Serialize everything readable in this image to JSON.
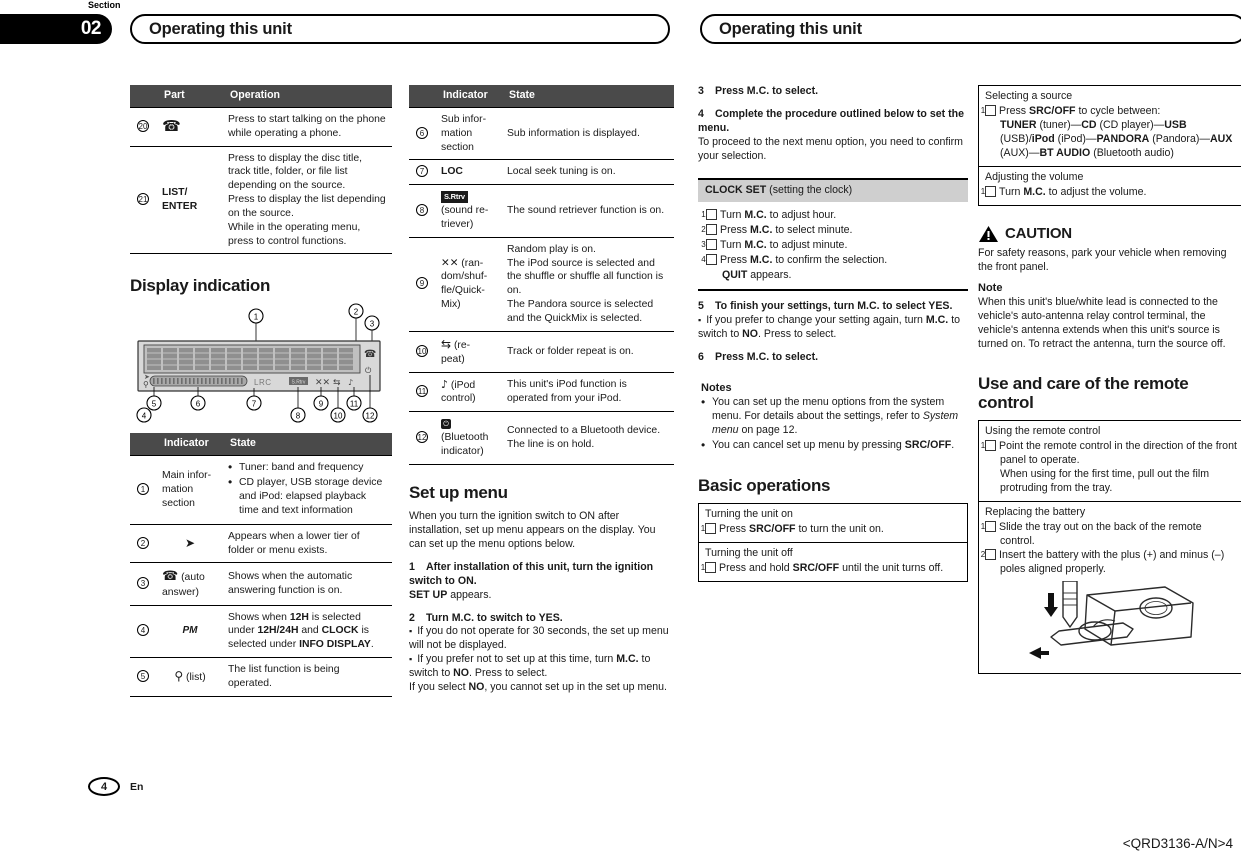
{
  "header": {
    "section_word": "Section",
    "section_number": "02",
    "title_left": "Operating this unit",
    "title_right": "Operating this unit"
  },
  "footer": {
    "page_number": "4",
    "language": "En",
    "part_number": "<QRD3136-A/N>4"
  },
  "col1": {
    "part_table": {
      "headers": {
        "num": "",
        "part": "Part",
        "operation": "Operation"
      },
      "rows": [
        {
          "num": "20",
          "part_icon": "phone-handset-icon",
          "part": "",
          "operation": "Press to start talking on the phone while operating a phone."
        },
        {
          "num": "21",
          "part_icon": "",
          "part": "LIST/ENTER",
          "operation": "Press to display the disc title, track title, folder, or file list depending on the source. Press to display the list depending on the source. While in the operating menu, press to control functions."
        }
      ]
    },
    "display_heading": "Display indication",
    "figure_callouts": [
      "1",
      "2",
      "3",
      "4",
      "5",
      "6",
      "7",
      "8",
      "9",
      "10",
      "11",
      "12"
    ],
    "figure_labels": {
      "lrc": "LRC",
      "sr": "S.Rtrv"
    },
    "indicator_table": {
      "headers": {
        "num": "",
        "indicator": "Indicator",
        "state": "State"
      },
      "rows": [
        {
          "num": "1",
          "indicator": "Main information section",
          "bullets": [
            "Tuner: band and frequency",
            "CD player, USB storage device and iPod: elapsed playback time and text information"
          ]
        },
        {
          "num": "2",
          "indicator_icon": "lower-tier-arrow-icon",
          "indicator": "",
          "state": "Appears when a lower tier of folder or menu exists."
        },
        {
          "num": "3",
          "indicator_icon": "phone-handset-icon",
          "indicator": "(auto answer)",
          "state": "Shows when the automatic answering function is on."
        },
        {
          "num": "4",
          "indicator_icon": "pm-icon",
          "indicator": "PM",
          "state": "Shows when 12H is selected under 12H/24H and CLOCK is selected under INFO DISPLAY."
        },
        {
          "num": "5",
          "indicator_icon": "list-magnifier-icon",
          "indicator": "(list)",
          "state": "The list function is being operated."
        }
      ]
    }
  },
  "col2": {
    "indicator_table": {
      "headers": {
        "num": "",
        "indicator": "Indicator",
        "state": "State"
      },
      "rows": [
        {
          "num": "6",
          "indicator": "Sub information section",
          "state": "Sub information is displayed."
        },
        {
          "num": "7",
          "indicator": "LOC",
          "state": "Local seek tuning is on."
        },
        {
          "num": "8",
          "indicator_badge": "S.Rtrv",
          "indicator": "(sound retriever)",
          "state": "The sound retriever function is on."
        },
        {
          "num": "9",
          "indicator_icon": "random-shuffle-icon",
          "indicator": "(random/shuffle/QuickMix)",
          "state": "Random play is on.\nThe iPod source is selected and the shuffle or shuffle all function is on.\nThe Pandora source is selected and the QuickMix is selected."
        },
        {
          "num": "10",
          "indicator_icon": "repeat-icon",
          "indicator": "(repeat)",
          "state": "Track or folder repeat is on."
        },
        {
          "num": "11",
          "indicator_icon": "ipod-control-icon",
          "indicator": "(iPod control)",
          "state": "This unit's iPod function is operated from your iPod."
        },
        {
          "num": "12",
          "indicator_icon": "bluetooth-icon",
          "indicator": "(Bluetooth indicator)",
          "state": "Connected to a Bluetooth device.\nThe line is on hold."
        }
      ]
    },
    "setup_heading": "Set up menu",
    "setup_intro": "When you turn the ignition switch to ON after installation, set up menu appears on the display. You can set up the menu options below.",
    "step1_num": "1",
    "step1_title": "After installation of this unit, turn the ignition switch to ON.",
    "step1_body_bold": "SET UP",
    "step1_body_rest": " appears.",
    "step2_num": "2",
    "step2_title": "Turn M.C. to switch to YES.",
    "step2_note1": "If you do not operate for 30 seconds, the set up menu will not be displayed.",
    "step2_note2_a": "If you prefer not to set up at this time, turn ",
    "step2_note2_b": "M.C.",
    "step2_note2_c": " to switch to ",
    "step2_note2_d": "NO",
    "step2_note2_e": ". Press to select.",
    "step2_tail_a": "If you select ",
    "step2_tail_b": "NO",
    "step2_tail_c": ", you cannot set up in the set up menu."
  },
  "col3": {
    "step3_num": "3",
    "step3_title": "Press M.C. to select.",
    "step4_num": "4",
    "step4_title": "Complete the procedure outlined below to set the menu.",
    "step4_body": "To proceed to the next menu option, you need to confirm your selection.",
    "clock_set_bold": "CLOCK SET",
    "clock_set_rest": " (setting the clock)",
    "clock_steps": [
      {
        "n": "1",
        "text_a": "Turn ",
        "bold": "M.C.",
        "text_b": " to adjust hour."
      },
      {
        "n": "2",
        "text_a": "Press ",
        "bold": "M.C.",
        "text_b": " to select minute."
      },
      {
        "n": "3",
        "text_a": "Turn ",
        "bold": "M.C.",
        "text_b": " to adjust minute."
      },
      {
        "n": "4",
        "text_a": "Press ",
        "bold": "M.C.",
        "text_b": " to confirm the selection."
      }
    ],
    "clock_quit_bold": "QUIT",
    "clock_quit_rest": " appears.",
    "step5_num": "5",
    "step5_title": "To finish your settings, turn M.C. to select YES.",
    "step5_note_a": "If you prefer to change your setting again, turn ",
    "step5_note_b": "M.C.",
    "step5_note_c": " to switch to ",
    "step5_note_d": "NO",
    "step5_note_e": ". Press to select.",
    "step6_num": "6",
    "step6_title": "Press M.C. to select.",
    "notes_heading": "Notes",
    "note1_a": "You can set up the menu options from the system menu. For details about the settings, refer to ",
    "note1_italic": "System menu",
    "note1_b": " on page 12.",
    "note2_a": "You can cancel set up menu by pressing ",
    "note2_bold": "SRC/OFF",
    "note2_b": ".",
    "basic_heading": "Basic operations",
    "basic_box": [
      {
        "title": "Turning the unit on",
        "n": "1",
        "text_a": "Press ",
        "bold": "SRC/OFF",
        "text_b": " to turn the unit on."
      },
      {
        "title": "Turning the unit off",
        "n": "1",
        "text_a": "Press and hold ",
        "bold": "SRC/OFF",
        "text_b": " until the unit turns off."
      }
    ]
  },
  "col4": {
    "source_box": {
      "title": "Selecting a source",
      "n": "1",
      "lead_a": "Press ",
      "lead_bold": "SRC/OFF",
      "lead_b": " to cycle between:",
      "chain": [
        {
          "bold": "TUNER",
          "plain": " (tuner)—"
        },
        {
          "bold": "CD",
          "plain": " (CD player)—"
        },
        {
          "bold": "USB",
          "plain": " (USB)/"
        },
        {
          "bold": "iPod",
          "plain": " (iPod)—"
        },
        {
          "bold": "PANDORA",
          "plain": " (Pandora)—"
        },
        {
          "bold": "AUX",
          "plain": " (AUX)—"
        },
        {
          "bold": "BT AUDIO",
          "plain": " (Bluetooth audio)"
        }
      ]
    },
    "volume_box": {
      "title": "Adjusting the volume",
      "n": "1",
      "text_a": "Turn ",
      "bold": "M.C.",
      "text_b": " to adjust the volume."
    },
    "caution_label": "CAUTION",
    "caution_body": "For safety reasons, park your vehicle when removing the front panel.",
    "note_heading": "Note",
    "note_body": "When this unit's blue/white lead is connected to the vehicle's auto-antenna relay control terminal, the vehicle's antenna extends when this unit's source is turned on. To retract the antenna, turn the source off.",
    "remote_heading": "Use and care of the remote control",
    "remote_box": {
      "title": "Using the remote control",
      "n": "1",
      "line1": "Point the remote control in the direction of the front panel to operate.",
      "line2": "When using for the first time, pull out the film protruding from the tray."
    },
    "battery_box": {
      "title": "Replacing the battery",
      "items": [
        {
          "n": "1",
          "text": "Slide the tray out on the back of the remote control."
        },
        {
          "n": "2",
          "text": "Insert the battery with the plus (+) and minus (–) poles aligned properly."
        }
      ]
    }
  },
  "colors": {
    "table_header_bg": "#4a4a4a",
    "grey_bar_bg": "#cfcfcf",
    "ink": "#1a1a1a"
  }
}
